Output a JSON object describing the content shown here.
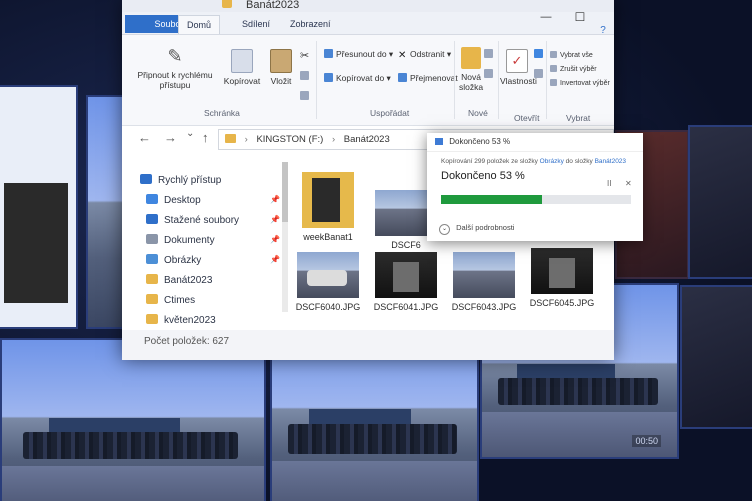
{
  "window": {
    "title": "Banát2023",
    "tabs": [
      "Soubor",
      "Domů",
      "Sdílení",
      "Zobrazení"
    ],
    "active_tab": "Domů",
    "controls": {
      "minimize": "—",
      "maximize": "☐",
      "help": "?"
    }
  },
  "ribbon": {
    "clipboard": {
      "pin_label": "Připnout k rychlému přístupu",
      "copy_label": "Kopírovat",
      "paste_label": "Vložit",
      "group_name": "Schránka"
    },
    "organize": {
      "move_to": "Přesunout do ▾",
      "copy_to": "Kopírovat do ▾",
      "delete": "Odstranit ▾",
      "rename": "Přejmenovat",
      "group_name": "Uspořádat"
    },
    "new": {
      "new_folder": "Nová složka",
      "group_name": "Nové"
    },
    "open": {
      "properties": "Vlastnosti",
      "group_name": "Otevřít"
    },
    "select": {
      "select_all": "Vybrat vše",
      "select_none": "Zrušit výběr",
      "invert": "Invertovat výběr",
      "group_name": "Vybrat"
    }
  },
  "address": {
    "back": "←",
    "forward": "→",
    "history": "⌄",
    "up": "↑",
    "path": [
      "KINGSTON (F:)",
      "Banát2023"
    ],
    "separator": "›"
  },
  "navigation": {
    "items": [
      {
        "label": "Rychlý přístup",
        "icon": "star-icon",
        "color": "#2f6fc9",
        "pinned": false
      },
      {
        "label": "Desktop",
        "icon": "desktop-icon",
        "color": "#3f86e0",
        "pinned": true
      },
      {
        "label": "Stažené soubory",
        "icon": "download-icon",
        "color": "#2f6fc9",
        "pinned": true
      },
      {
        "label": "Dokumenty",
        "icon": "document-icon",
        "color": "#8a95a8",
        "pinned": true
      },
      {
        "label": "Obrázky",
        "icon": "pictures-icon",
        "color": "#4c8fd6",
        "pinned": true
      },
      {
        "label": "Banát2023",
        "icon": "folder-icon",
        "color": "#e7b54a",
        "pinned": false
      },
      {
        "label": "Ctimes",
        "icon": "folder-icon",
        "color": "#e7b54a",
        "pinned": false
      },
      {
        "label": "květen2023",
        "icon": "folder-icon",
        "color": "#e7b54a",
        "pinned": false
      }
    ]
  },
  "files": [
    {
      "name": "weekBanat1",
      "kind": "folder"
    },
    {
      "name": "DSCF6",
      "kind": "photo"
    },
    {
      "name": "DSCF6040.JPG",
      "kind": "bus"
    },
    {
      "name": "DSCF6041.JPG",
      "kind": "dark"
    },
    {
      "name": "DSCF6043.JPG",
      "kind": "photo"
    },
    {
      "name": "DSCF6045.JPG",
      "kind": "dark"
    }
  ],
  "status": {
    "item_count": "Počet položek: 627"
  },
  "copy_dialog": {
    "title": "Dokončeno 53 %",
    "subtitle_prefix": "Kopírování 299 položek ze složky",
    "subtitle_source": "Obrázky",
    "subtitle_mid": "do složky",
    "subtitle_dest": "Banát2023",
    "percent_text": "Dokončeno 53 %",
    "progress": 0.53,
    "pause": "II",
    "cancel": "✕",
    "details": "Další podrobnosti",
    "bar_color": "#1f9a3d"
  },
  "background": {
    "video_duration": "00:50"
  }
}
